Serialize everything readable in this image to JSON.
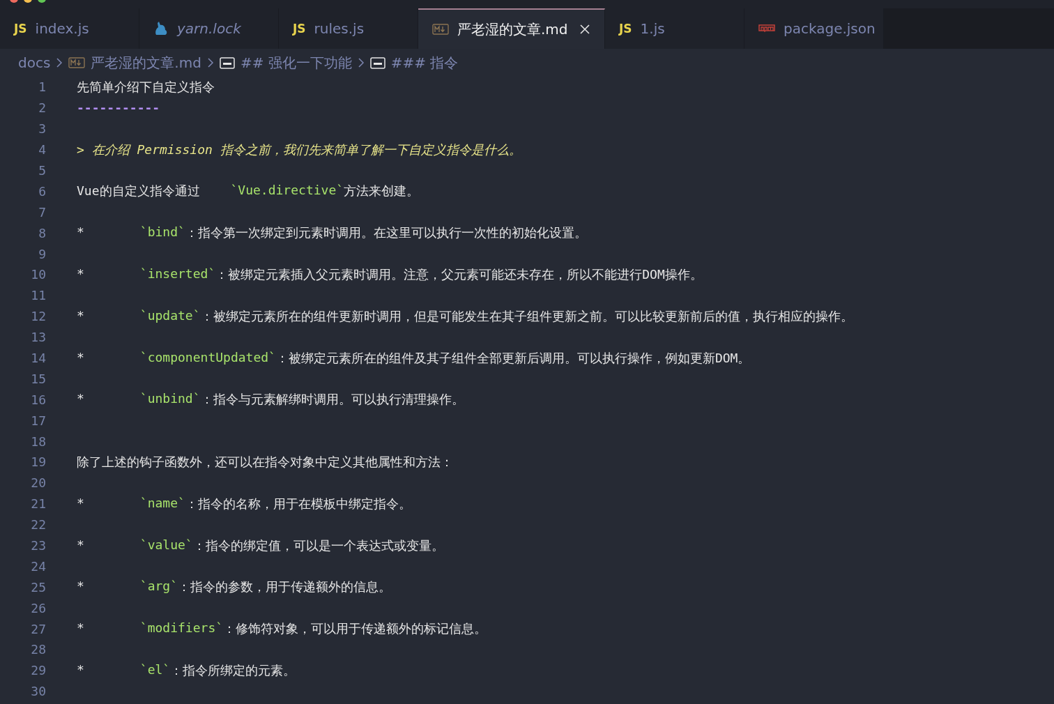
{
  "tabs": [
    {
      "kind": "js",
      "badge": "JS",
      "label": "index.js",
      "selected": false,
      "preview": false,
      "closable": false
    },
    {
      "kind": "yarn",
      "label": "yarn.lock",
      "selected": false,
      "preview": true,
      "closable": false
    },
    {
      "kind": "js",
      "badge": "JS",
      "label": "rules.js",
      "selected": false,
      "preview": false,
      "closable": false
    },
    {
      "kind": "markdown",
      "label": "严老湿的文章.md",
      "selected": true,
      "preview": false,
      "closable": true
    },
    {
      "kind": "js",
      "badge": "JS",
      "label": "1.js",
      "selected": false,
      "preview": false,
      "closable": false
    },
    {
      "kind": "npm",
      "label": "package.json",
      "selected": false,
      "preview": false,
      "closable": false
    }
  ],
  "breadcrumb": [
    {
      "kind": "folder",
      "label": "docs"
    },
    {
      "kind": "markdown",
      "label": "严老湿的文章.md"
    },
    {
      "kind": "heading",
      "label": "## 强化一下功能"
    },
    {
      "kind": "heading",
      "label": "### 指令"
    }
  ],
  "lines": [
    {
      "number": "1",
      "segments": [
        {
          "kind": "plain",
          "text": "先简单介绍下自定义指令"
        }
      ]
    },
    {
      "number": "2",
      "segments": [
        {
          "kind": "rule",
          "text": "-----------"
        }
      ]
    },
    {
      "number": "3"
    },
    {
      "number": "4",
      "segments": [
        {
          "kind": "quote",
          "text": "> 在介绍 Permission 指令之前，我们先来简单了解一下自定义指令是什么。"
        }
      ]
    },
    {
      "number": "5"
    },
    {
      "number": "6",
      "segments": [
        {
          "kind": "plain",
          "text": "Vue的自定义指令通过"
        },
        {
          "kind": "code",
          "text": "`Vue.directive`"
        },
        {
          "kind": "plain",
          "text": "方法来创建。"
        }
      ]
    },
    {
      "number": "7"
    },
    {
      "number": "8",
      "segments": [
        {
          "kind": "bullet",
          "text": "*"
        },
        {
          "kind": "code",
          "text": "`bind`"
        },
        {
          "kind": "plain",
          "text": "：指令第一次绑定到元素时调用。在这里可以执行一次性的初始化设置。"
        }
      ]
    },
    {
      "number": "9"
    },
    {
      "number": "10",
      "segments": [
        {
          "kind": "bullet",
          "text": "*"
        },
        {
          "kind": "code",
          "text": "`inserted`"
        },
        {
          "kind": "plain",
          "text": "：被绑定元素插入父元素时调用。注意，父元素可能还未存在，所以不能进行DOM操作。"
        }
      ]
    },
    {
      "number": "11"
    },
    {
      "number": "12",
      "segments": [
        {
          "kind": "bullet",
          "text": "*"
        },
        {
          "kind": "code",
          "text": "`update`"
        },
        {
          "kind": "plain",
          "text": "：被绑定元素所在的组件更新时调用，但是可能发生在其子组件更新之前。可以比较更新前后的值，执行相应的操作。"
        }
      ]
    },
    {
      "number": "13"
    },
    {
      "number": "14",
      "segments": [
        {
          "kind": "bullet",
          "text": "*"
        },
        {
          "kind": "code",
          "text": "`componentUpdated`"
        },
        {
          "kind": "plain",
          "text": "：被绑定元素所在的组件及其子组件全部更新后调用。可以执行操作，例如更新DOM。"
        }
      ]
    },
    {
      "number": "15"
    },
    {
      "number": "16",
      "segments": [
        {
          "kind": "bullet",
          "text": "*"
        },
        {
          "kind": "code",
          "text": "`unbind`"
        },
        {
          "kind": "plain",
          "text": "：指令与元素解绑时调用。可以执行清理操作。"
        }
      ]
    },
    {
      "number": "17"
    },
    {
      "number": "18"
    },
    {
      "number": "19",
      "segments": [
        {
          "kind": "plain",
          "text": "除了上述的钩子函数外，还可以在指令对象中定义其他属性和方法："
        }
      ]
    },
    {
      "number": "20"
    },
    {
      "number": "21",
      "segments": [
        {
          "kind": "bullet",
          "text": "*"
        },
        {
          "kind": "code",
          "text": "`name`"
        },
        {
          "kind": "plain",
          "text": "：指令的名称，用于在模板中绑定指令。"
        }
      ]
    },
    {
      "number": "22"
    },
    {
      "number": "23",
      "segments": [
        {
          "kind": "bullet",
          "text": "*"
        },
        {
          "kind": "code",
          "text": "`value`"
        },
        {
          "kind": "plain",
          "text": "：指令的绑定值，可以是一个表达式或变量。"
        }
      ]
    },
    {
      "number": "24"
    },
    {
      "number": "25",
      "segments": [
        {
          "kind": "bullet",
          "text": "*"
        },
        {
          "kind": "code",
          "text": "`arg`"
        },
        {
          "kind": "plain",
          "text": "：指令的参数，用于传递额外的信息。"
        }
      ]
    },
    {
      "number": "26"
    },
    {
      "number": "27",
      "segments": [
        {
          "kind": "bullet",
          "text": "*"
        },
        {
          "kind": "code",
          "text": "`modifiers`"
        },
        {
          "kind": "plain",
          "text": "：修饰符对象，可以用于传递额外的标记信息。"
        }
      ]
    },
    {
      "number": "28"
    },
    {
      "number": "29",
      "segments": [
        {
          "kind": "bullet",
          "text": "*"
        },
        {
          "kind": "code",
          "text": "`el`"
        },
        {
          "kind": "plain",
          "text": "：指令所绑定的元素。"
        }
      ]
    },
    {
      "number": "30"
    }
  ]
}
